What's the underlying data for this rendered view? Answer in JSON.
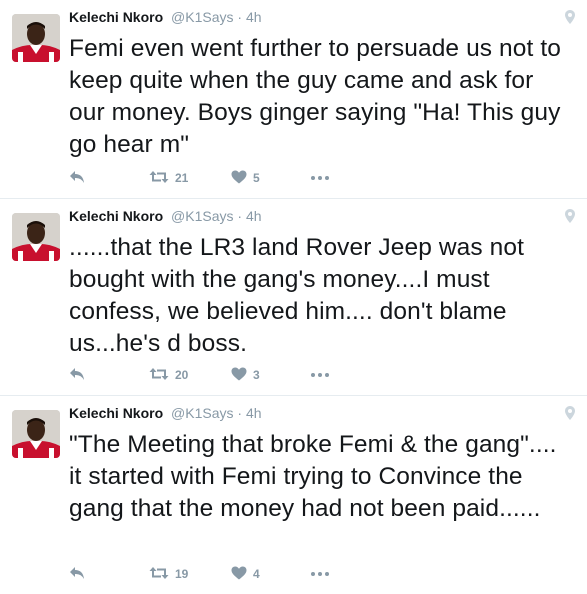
{
  "colors": {
    "text": "#14171a",
    "muted": "#8899a6",
    "divider": "#e6ecf0",
    "jersey_red": "#c8102e"
  },
  "tweets": [
    {
      "name": "Kelechi Nkoro",
      "handle": "@K1Says",
      "dot": "·",
      "time": "4h",
      "text": "Femi even went further to persuade us not to keep quite when the guy came and ask for our money. Boys ginger saying \"Ha! This guy go hear m\"",
      "retweets": "21",
      "likes": "5",
      "icons": [
        "reply-icon",
        "retweet-icon",
        "heart-icon",
        "more-icon",
        "location-pin-icon"
      ]
    },
    {
      "name": "Kelechi Nkoro",
      "handle": "@K1Says",
      "dot": "·",
      "time": "4h",
      "text": "......that the LR3 land Rover Jeep was not bought with the gang's money....I must confess, we believed him.... don't blame us...he's d boss.",
      "retweets": "20",
      "likes": "3",
      "icons": [
        "reply-icon",
        "retweet-icon",
        "heart-icon",
        "more-icon",
        "location-pin-icon"
      ]
    },
    {
      "name": "Kelechi Nkoro",
      "handle": "@K1Says",
      "dot": "·",
      "time": "4h",
      "text": "\"The Meeting that broke Femi & the gang\".... it started with Femi trying to Convince the gang that the money had not been paid......",
      "retweets": "19",
      "likes": "4",
      "icons": [
        "reply-icon",
        "retweet-icon",
        "heart-icon",
        "more-icon",
        "location-pin-icon"
      ]
    }
  ]
}
